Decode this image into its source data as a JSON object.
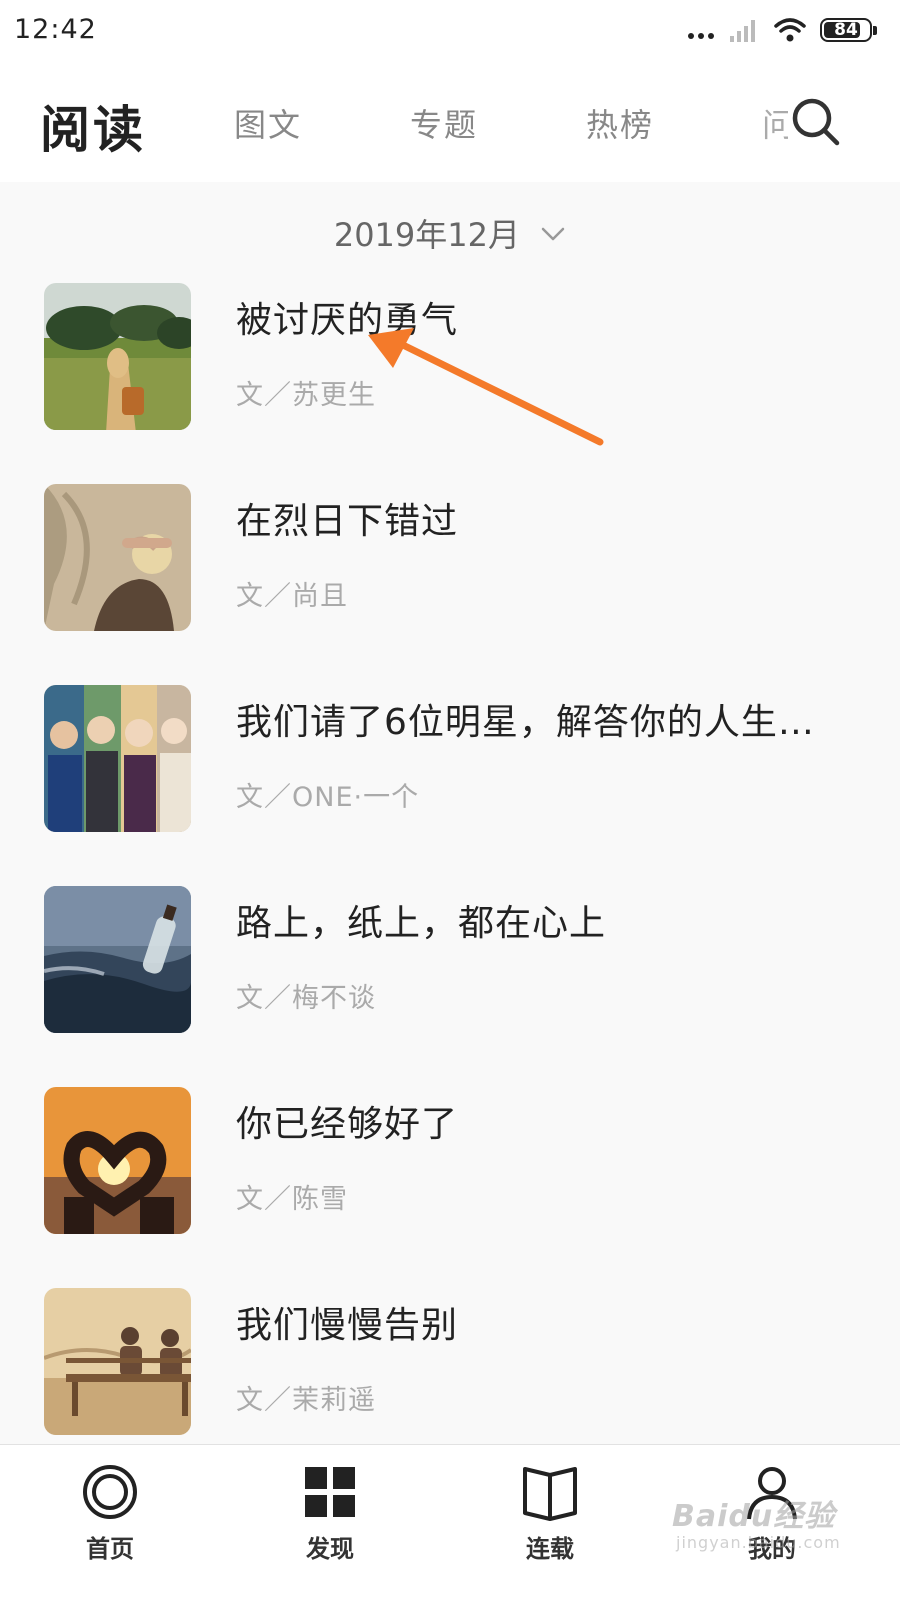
{
  "status_bar": {
    "time": "12:42",
    "battery": "84",
    "battery_level": 0.84
  },
  "header": {
    "title": "阅读",
    "tabs": [
      "图文",
      "专题",
      "热榜",
      "问"
    ]
  },
  "month_selector": {
    "label": "2019年12月"
  },
  "articles": [
    {
      "title": "被讨厌的勇气",
      "author": "文／苏更生"
    },
    {
      "title": "在烈日下错过",
      "author": "文／尚且"
    },
    {
      "title": "我们请了6位明星，解答你的人生…",
      "author": "文／ONE·一个"
    },
    {
      "title": "路上，纸上，都在心上",
      "author": "文／梅不谈"
    },
    {
      "title": "你已经够好了",
      "author": "文／陈雪"
    },
    {
      "title": "我们慢慢告别",
      "author": "文／茉莉遥"
    }
  ],
  "bottom_nav": [
    {
      "label": "首页",
      "icon": "home-icon"
    },
    {
      "label": "发现",
      "icon": "grid-icon"
    },
    {
      "label": "连载",
      "icon": "book-icon"
    },
    {
      "label": "我的",
      "icon": "user-icon"
    }
  ],
  "watermark": {
    "text": "Baidu经验",
    "sub": "jingyan.baidu.com"
  },
  "colors": {
    "arrow": "#f47a2a",
    "title": "#222222",
    "muted": "#aaaaaa",
    "tab": "#888888"
  }
}
